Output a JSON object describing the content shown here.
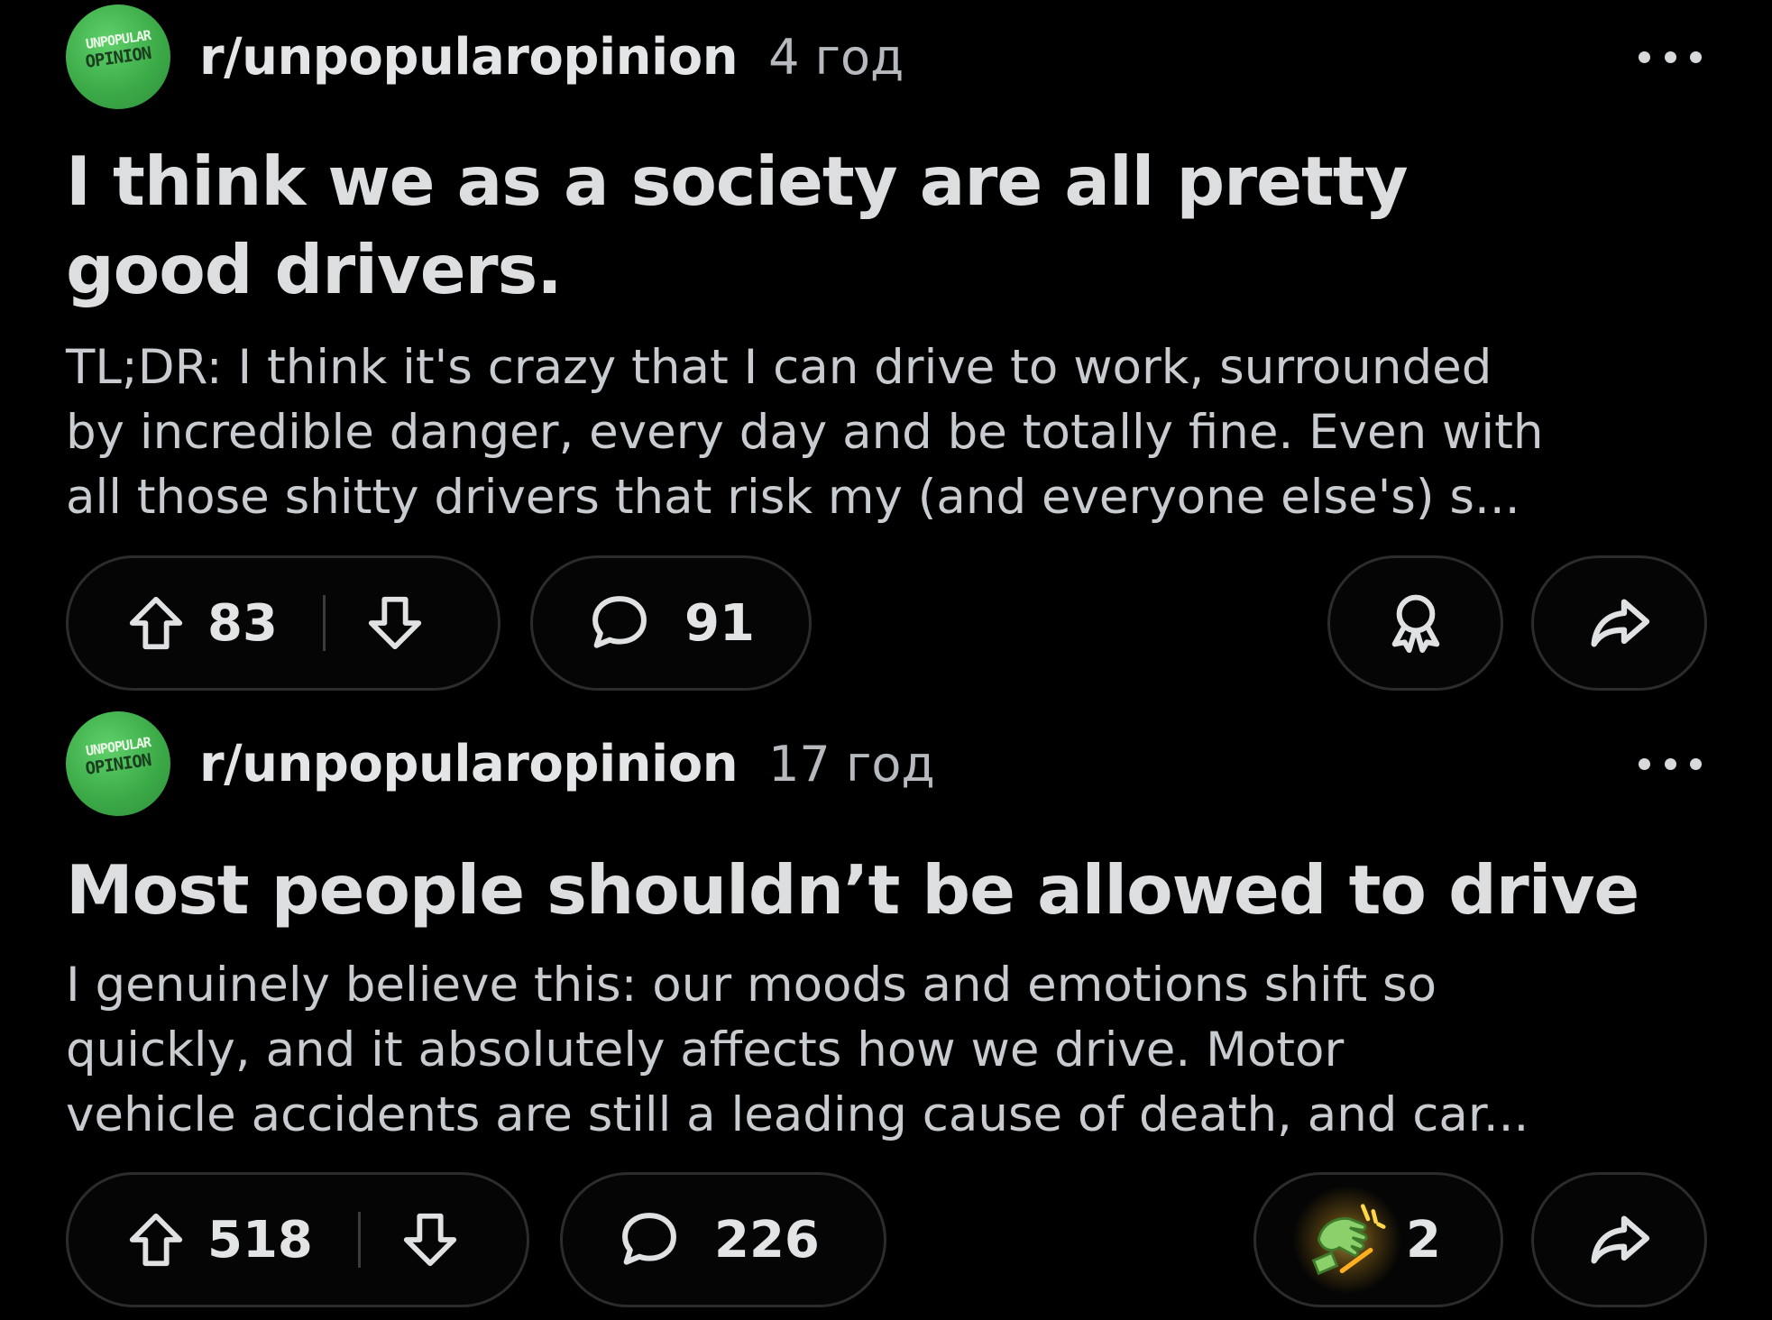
{
  "posts": [
    {
      "subreddit": "r/unpopularopinion",
      "avatar_text_top": "UNPOPULAR",
      "avatar_text_bottom": "OPINION",
      "time": "4 год",
      "title_line1": "I think we as a society are all pretty",
      "title_line2": "good drivers.",
      "body_line1": "TL;DR: I think it's crazy that I can drive to work, surrounded",
      "body_line2": "by incredible danger, every day and be totally fine. Even with",
      "body_line3": "all those shitty drivers that risk my (and everyone else's) s...",
      "upvotes": "83",
      "comments": "91"
    },
    {
      "subreddit": "r/unpopularopinion",
      "avatar_text_top": "UNPOPULAR",
      "avatar_text_bottom": "OPINION",
      "time": "17 год",
      "title_line1": "Most people shouldn’t be allowed to drive",
      "body_line1": "I genuinely believe this: our moods and emotions shift so",
      "body_line2": "quickly, and it absolutely affects how we drive. Motor",
      "body_line3": "vehicle accidents are still a leading cause of death, and car...",
      "upvotes": "518",
      "comments": "226",
      "awards": "2"
    }
  ],
  "icons": {
    "upvote": "arrow-up-icon",
    "downvote": "arrow-down-icon",
    "comment": "speech-bubble-icon",
    "award": "award-ribbon-icon",
    "share": "share-arrow-icon",
    "more": "ellipsis-icon"
  },
  "colors": {
    "background": "#000000",
    "avatar_green": "#3cab48",
    "text_primary": "#dcdee0",
    "text_secondary": "#b6babe",
    "pill_border": "#2a2c2e"
  }
}
